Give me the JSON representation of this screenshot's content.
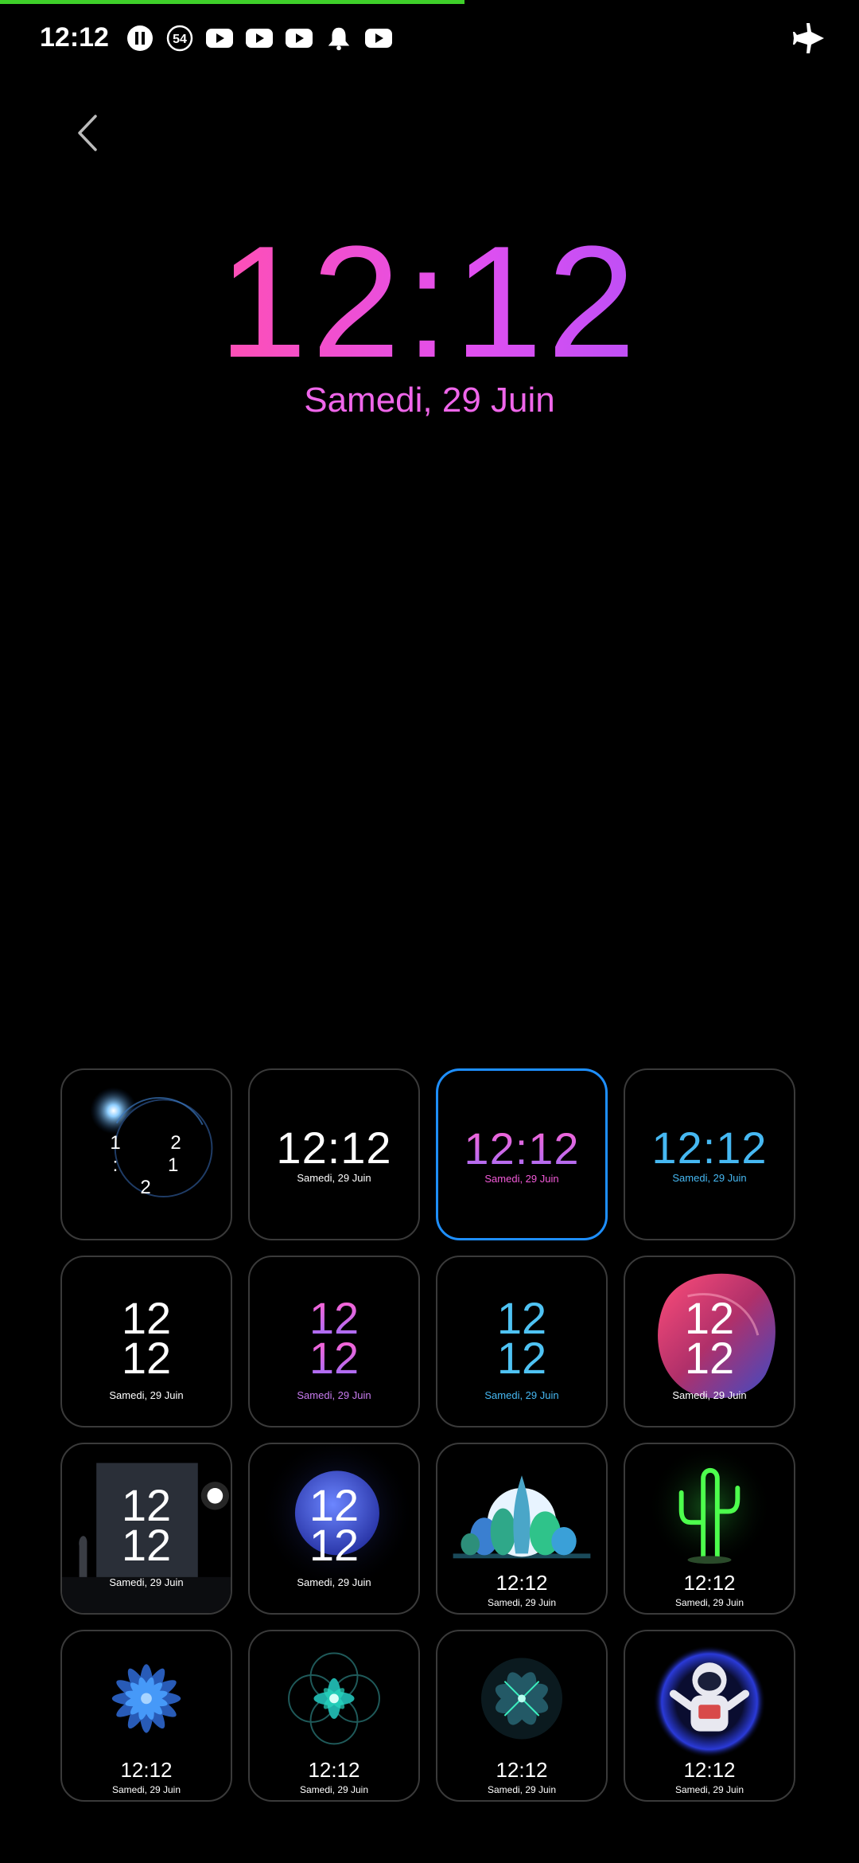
{
  "status_bar": {
    "time": "12:12",
    "badge_count": "54",
    "icons": [
      "pause-icon",
      "counter-54-icon",
      "youtube-icon",
      "youtube-icon",
      "youtube-icon",
      "notification-bell-icon",
      "youtube-icon",
      "airplane-mode-icon"
    ],
    "progress_color": "#3fcf2a"
  },
  "navigation": {
    "back_icon": "chevron-left-icon"
  },
  "preview": {
    "time": "12:12",
    "date": "Samedi, 29 Juin",
    "colors": [
      "#ff4fb3",
      "#e04ff0",
      "#b44ff7"
    ]
  },
  "styles": {
    "selected_index": 2,
    "tiles": [
      {
        "time": "1 2 : 1 2",
        "date": "",
        "art": "eclipse"
      },
      {
        "time": "12:12",
        "date": "Samedi, 29 Juin",
        "art": "plain-white"
      },
      {
        "time": "12:12",
        "date": "Samedi, 29 Juin",
        "art": "pink-gradient"
      },
      {
        "time": "12:12",
        "date": "Samedi, 29 Juin",
        "art": "blue"
      },
      {
        "hour": "12",
        "minute": "12",
        "date": "Samedi, 29 Juin",
        "art": "stack-white"
      },
      {
        "hour": "12",
        "minute": "12",
        "date": "Samedi, 29 Juin",
        "art": "stack-pink"
      },
      {
        "hour": "12",
        "minute": "12",
        "date": "Samedi, 29 Juin",
        "art": "stack-blue"
      },
      {
        "hour": "12",
        "minute": "12",
        "date": "Samedi, 29 Juin",
        "art": "color-blob"
      },
      {
        "hour": "12",
        "minute": "12",
        "date": "Samedi, 29 Juin",
        "art": "doorway"
      },
      {
        "hour": "12",
        "minute": "12",
        "date": "Samedi, 29 Juin",
        "art": "planet"
      },
      {
        "time": "12:12",
        "date": "Samedi, 29 Juin",
        "art": "forest"
      },
      {
        "time": "12:12",
        "date": "Samedi, 29 Juin",
        "art": "neon-cactus"
      },
      {
        "time": "12:12",
        "date": "Samedi, 29 Juin",
        "art": "blue-flower"
      },
      {
        "time": "12:12",
        "date": "Samedi, 29 Juin",
        "art": "teal-flower"
      },
      {
        "time": "12:12",
        "date": "Samedi, 29 Juin",
        "art": "kaleidoscope"
      },
      {
        "time": "12:12",
        "date": "Samedi, 29 Juin",
        "art": "astronaut"
      }
    ]
  }
}
